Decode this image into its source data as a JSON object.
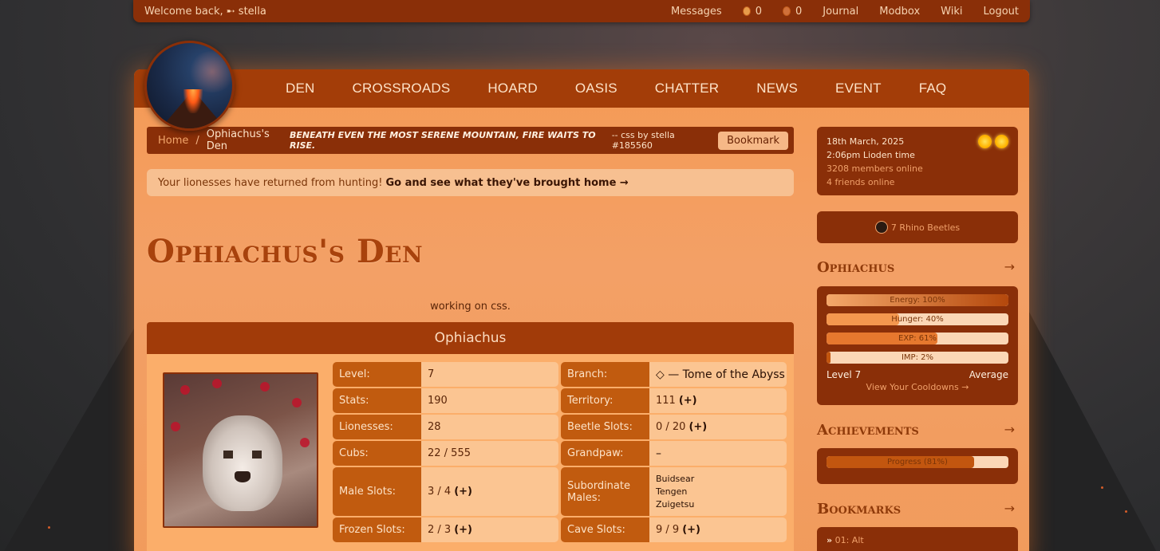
{
  "topbar": {
    "welcome": "Welcome back,",
    "user": "➸ stella",
    "messages": "Messages",
    "coins_a": "0",
    "coins_b": "0",
    "journal": "Journal",
    "modbox": "Modbox",
    "wiki": "Wiki",
    "logout": "Logout"
  },
  "nav": [
    "DEN",
    "CROSSROADS",
    "HOARD",
    "OASIS",
    "CHATTER",
    "NEWS",
    "EVENT",
    "FAQ"
  ],
  "breadcrumb": {
    "home": "Home",
    "sep": "/",
    "current": "Ophiachus's Den",
    "quote": "BENEATH EVEN THE MOST SERENE MOUNTAIN, FIRE WAITS TO RISE.",
    "credit": "-- css by stella #185560",
    "bookmark_label": "Bookmark"
  },
  "alert": {
    "text": "Your lionesses have returned from hunting!",
    "link": "Go and see what they've brought home →"
  },
  "den_title": "Ophiachus's Den",
  "status_text": "working on css.",
  "lion": {
    "name": "Ophiachus",
    "stats": {
      "level_label": "Level:",
      "level": "7",
      "branch_label": "Branch:",
      "branch": "◇ — Tome of the Abyss",
      "stats_label": "Stats:",
      "stats": "190",
      "territory_label": "Territory:",
      "territory": "111",
      "lionesses_label": "Lionesses:",
      "lionesses": "28",
      "beetle_label": "Beetle Slots:",
      "beetle": "0 / 20",
      "cubs_label": "Cubs:",
      "cubs": "22 / 555",
      "grandpaw_label": "Grandpaw:",
      "grandpaw": "–",
      "male_label": "Male Slots:",
      "male": "3 / 4",
      "sub_label": "Subordinate Males:",
      "sub_1": "Buidsear",
      "sub_2": "Tengen",
      "sub_3": "Zuigetsu",
      "frozen_label": "Frozen Slots:",
      "frozen": "2 / 3",
      "cave_label": "Cave Slots:",
      "cave": "9 / 9",
      "plus": "(+)"
    }
  },
  "sidebar": {
    "date": "18th March, 2025",
    "time": "2:06pm Lioden time",
    "members": "3208 members online",
    "friends": "4 friends online",
    "beetles": "7 Rhino Beetles",
    "lion_title": "Ophiachus",
    "arrow": "→",
    "bars": {
      "energy": "Energy: 100%",
      "energy_value": 100,
      "hunger": "Hunger: 40%",
      "hunger_value": 40,
      "exp": "EXP: 61%",
      "exp_value": 61,
      "imp": "IMP: 2%",
      "imp_value": 2
    },
    "level": "Level 7",
    "mood": "Average",
    "cooldowns": "View Your Cooldowns →",
    "achievements_title": "Achievements",
    "progress": "Progress (81%)",
    "progress_value": 81,
    "bookmarks_title": "Bookmarks",
    "bookmark_1": "01: Alt",
    "bookmark_bullet": "»"
  },
  "colors": {
    "accent": "#8a2f08",
    "nav": "#a33d08",
    "panel": "#f59a55",
    "label_cell": "#c15b0f",
    "value_cell": "#fbc592"
  }
}
